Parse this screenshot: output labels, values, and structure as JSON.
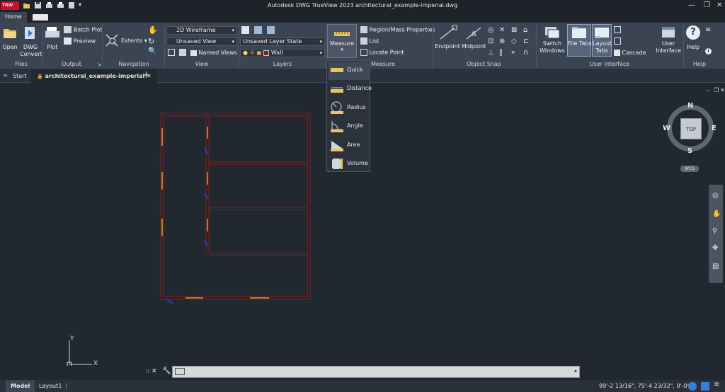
{
  "window": {
    "app_badge": "TRW",
    "title": "Autodesk DWG TrueView 2023    architectural_example-imperial.dwg"
  },
  "ribbon_tabs": [
    "Home"
  ],
  "ribbon": {
    "files": {
      "panel": "Files",
      "open": "Open",
      "dwg_convert": "DWG Convert"
    },
    "output": {
      "panel": "Output",
      "plot": "Plot",
      "batch_plot": "Batch Plot",
      "preview": "Preview"
    },
    "navigation": {
      "panel": "Navigation",
      "extents": "Extents"
    },
    "view": {
      "panel": "View",
      "visual_style": "2D Wireframe",
      "saved_view": "Unsaved View",
      "named_views": "Named Views"
    },
    "layers": {
      "panel": "Layers",
      "layer_state": "Unsaved Layer State",
      "current_layer": "Wall"
    },
    "measure": {
      "panel": "Measure",
      "measure_button": "Measure",
      "region_mass": "Region/Mass Properties",
      "list": "List",
      "locate_point": "Locate Point"
    },
    "object_snap": {
      "panel": "Object Snap",
      "endpoint": "Endpoint",
      "midpoint": "Midpoint"
    },
    "user_interface": {
      "panel": "User Interface",
      "switch_windows": "Switch Windows",
      "file_tabs": "File Tabs",
      "layout_tabs": "Layout Tabs",
      "cascade": "Cascade",
      "user_interface": "User Interface"
    },
    "help": {
      "panel": "Help",
      "help": "Help"
    }
  },
  "doc_tabs": {
    "start": "Start",
    "active": "architectural_example-imperial"
  },
  "measure_menu": [
    {
      "label": "Quick",
      "icon": "quick-measure-icon"
    },
    {
      "label": "Distance",
      "icon": "distance-icon"
    },
    {
      "label": "Radius",
      "icon": "radius-icon"
    },
    {
      "label": "Angle",
      "icon": "angle-icon"
    },
    {
      "label": "Area",
      "icon": "area-icon"
    },
    {
      "label": "Volume",
      "icon": "volume-icon"
    }
  ],
  "viewcube": {
    "n": "N",
    "s": "S",
    "e": "E",
    "w": "W",
    "face": "TOP",
    "wcs": "WCS"
  },
  "ucs": {
    "x": "X",
    "y": "Y"
  },
  "layout_tabs": [
    "Model",
    "Layout1"
  ],
  "status": {
    "coordinates": "99'-2 13/16\", 75'-4 23/32\", 0'-0\""
  },
  "colors": {
    "ribbon": "#3b4453",
    "canvas": "#212830",
    "wall": "#8b1a1a",
    "door": "#1d4fe0",
    "window": "#e0a020"
  }
}
